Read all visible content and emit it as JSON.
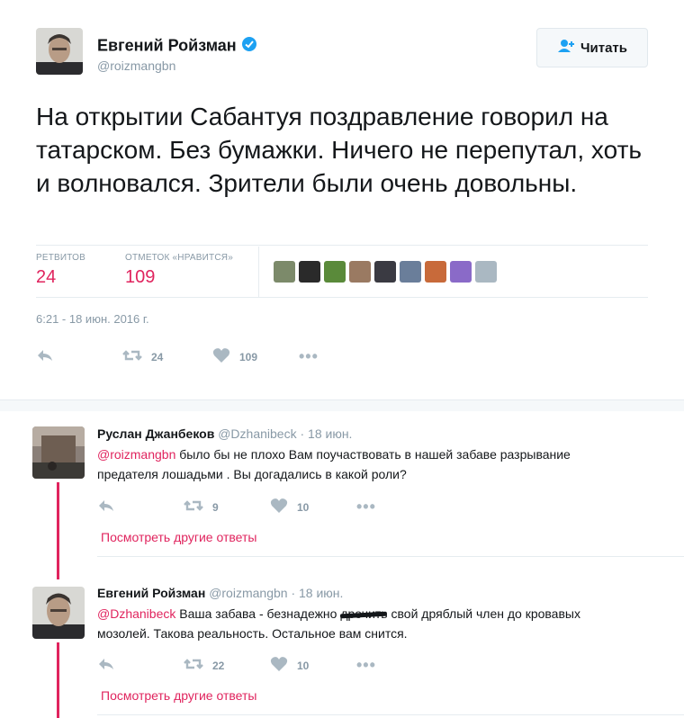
{
  "main_tweet": {
    "author_name": "Евгений Ройзман",
    "author_handle": "@roizmangbn",
    "follow_label": "Читать",
    "text": "На открытии Сабантуя поздравление говорил на татарском. Без бумажки. Ничего не перепутал, хоть и волновался. Зрители были очень довольны.",
    "retweets_label": "РЕТВИТОВ",
    "retweets_count": "24",
    "likes_label": "ОТМЕТОК «НРАВИТСЯ»",
    "likes_count": "109",
    "timestamp": "6:21 - 18 июн. 2016 г.",
    "action_retweet_count": "24",
    "action_like_count": "109"
  },
  "replies": [
    {
      "author_name": "Руслан Джанбеков",
      "author_handle": "@Dzhanibeck",
      "date": "· 18 июн.",
      "mention": "@roizmangbn",
      "text_rest": " было бы не плохо Вам поучаствовать в нашей забаве разрывание предателя лошадьми . Вы догадались в какой роли?",
      "retweet_count": "9",
      "like_count": "10",
      "more_label": "Посмотреть другие ответы"
    },
    {
      "author_name": "Евгений Ройзман",
      "author_handle": "@roizmangbn",
      "date": "· 18 июн.",
      "mention": "@Dzhanibeck",
      "text_part1": " Ваша забава - безнадежно ",
      "text_struck": "дрочить",
      "text_part2": " свой дряблый член до кровавых мозолей. Такова реальность. Остальное вам снится.",
      "retweet_count": "22",
      "like_count": "10",
      "more_label": "Посмотреть другие ответы"
    }
  ],
  "colors": {
    "accent": "#e0245e",
    "secondary_text": "#8899a6",
    "verified": "#1da1f2"
  }
}
